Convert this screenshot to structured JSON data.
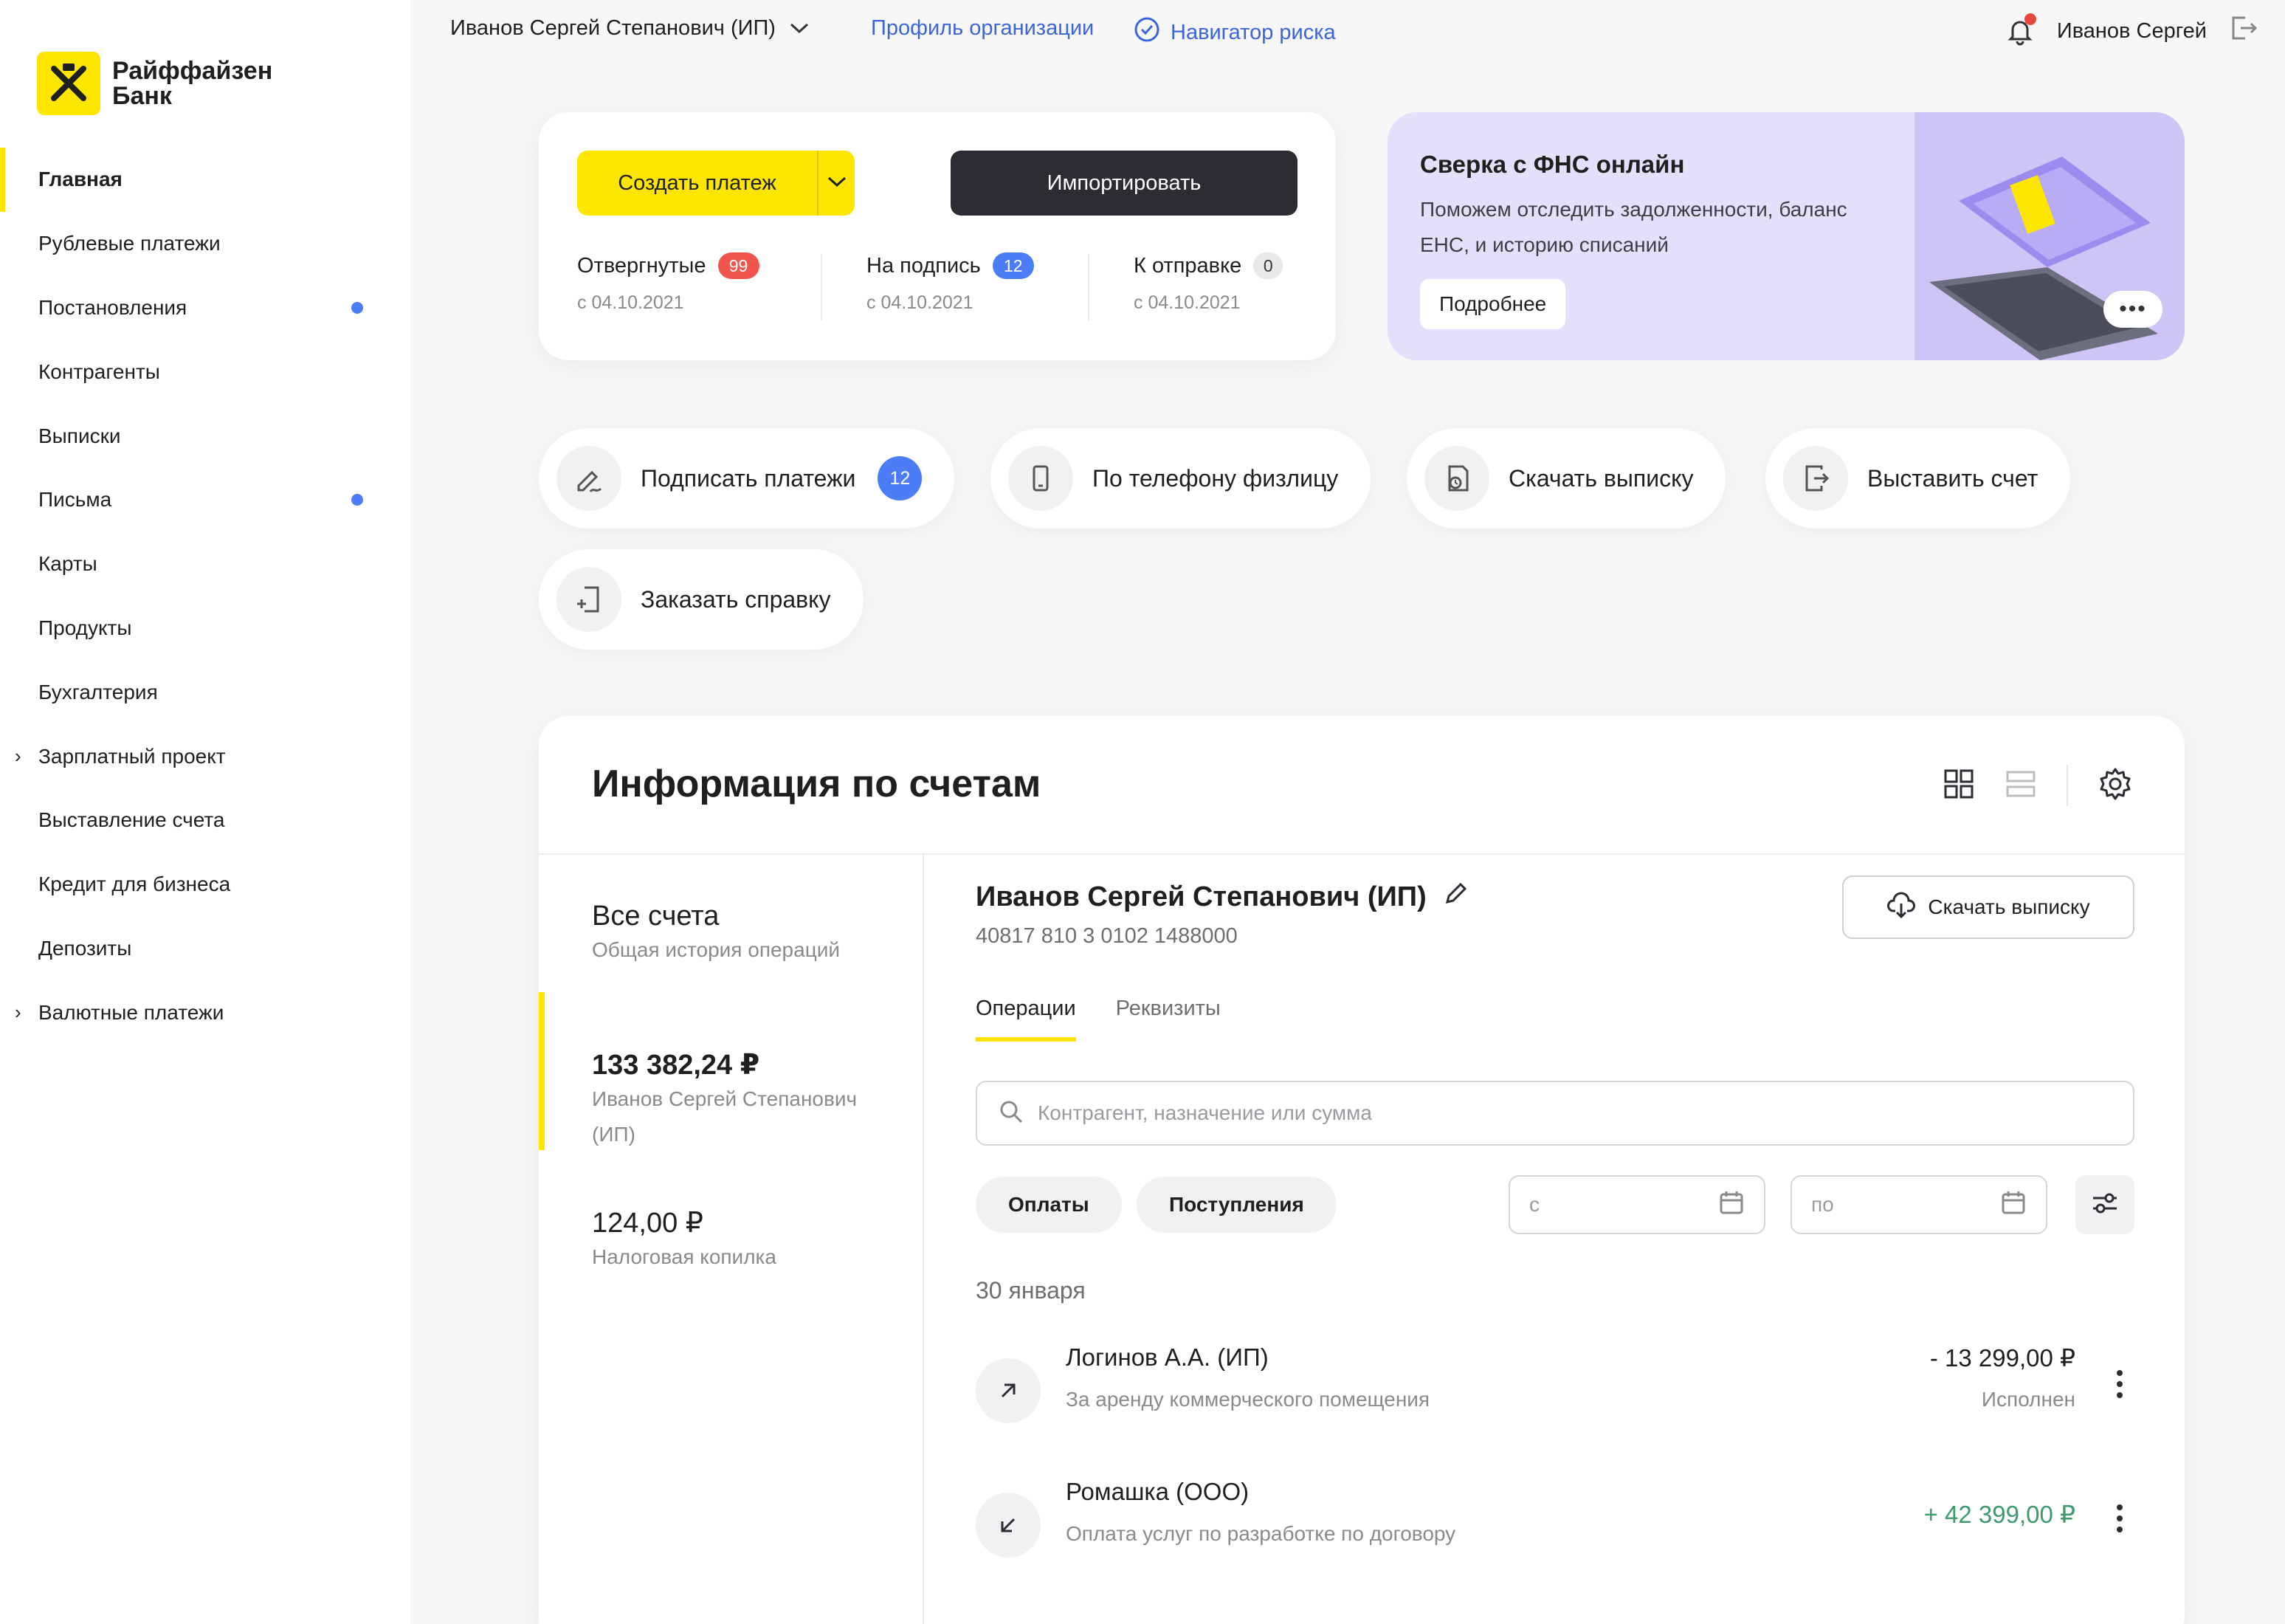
{
  "brand": {
    "name_line1": "Райффайзен",
    "name_line2": "Банк",
    "accent": "#fee600"
  },
  "sidebar": {
    "items": [
      {
        "label": "Главная",
        "active": true,
        "dot": false,
        "expandable": false
      },
      {
        "label": "Рублевые платежи",
        "active": false,
        "dot": false,
        "expandable": false
      },
      {
        "label": "Постановления",
        "active": false,
        "dot": true,
        "expandable": false
      },
      {
        "label": "Контрагенты",
        "active": false,
        "dot": false,
        "expandable": false
      },
      {
        "label": "Выписки",
        "active": false,
        "dot": false,
        "expandable": false
      },
      {
        "label": "Письма",
        "active": false,
        "dot": true,
        "expandable": false
      },
      {
        "label": "Карты",
        "active": false,
        "dot": false,
        "expandable": false
      },
      {
        "label": "Продукты",
        "active": false,
        "dot": false,
        "expandable": false
      },
      {
        "label": "Бухгалтерия",
        "active": false,
        "dot": false,
        "expandable": false
      },
      {
        "label": "Зарплатный проект",
        "active": false,
        "dot": false,
        "expandable": true
      },
      {
        "label": "Выставление счета",
        "active": false,
        "dot": false,
        "expandable": false
      },
      {
        "label": "Кредит для бизнеса",
        "active": false,
        "dot": false,
        "expandable": false
      },
      {
        "label": "Депозиты",
        "active": false,
        "dot": false,
        "expandable": false
      },
      {
        "label": "Валютные платежи",
        "active": false,
        "dot": false,
        "expandable": true
      }
    ]
  },
  "topbar": {
    "org_name": "Иванов Сергей Степанович (ИП)",
    "profile_link": "Профиль организации",
    "risk_link": "Навигатор риска",
    "user_name": "Иванов Сергей"
  },
  "payments": {
    "create_label": "Создать платеж",
    "import_label": "Импортировать",
    "stats": [
      {
        "label": "Отвергнутые",
        "count": "99",
        "date": "с 04.10.2021"
      },
      {
        "label": "На подпись",
        "count": "12",
        "date": "с 04.10.2021"
      },
      {
        "label": "К отправке",
        "count": "0",
        "date": "с 04.10.2021"
      }
    ]
  },
  "promo": {
    "title": "Сверка с ФНС онлайн",
    "text": "Поможем отследить задолженности, баланс ЕНС, и историю списаний",
    "button": "Подробнее",
    "more": "•••"
  },
  "quick_actions": [
    {
      "label": "Подписать платежи",
      "badge": "12"
    },
    {
      "label": "По телефону физлицу"
    },
    {
      "label": "Скачать выписку"
    },
    {
      "label": "Выставить счет"
    },
    {
      "label": "Заказать справку"
    }
  ],
  "accounts": {
    "title": "Информация по счетам",
    "all": {
      "title": "Все счета",
      "sub": "Общая история операций"
    },
    "list": [
      {
        "amount": "133 382,24 ₽",
        "name": "Иванов Сергей Степанович (ИП)"
      },
      {
        "amount": "124,00 ₽",
        "name": "Налоговая копилка"
      }
    ],
    "detail": {
      "name": "Иванов Сергей Степанович (ИП)",
      "number": "40817 810 3 0102 1488000",
      "download": "Скачать выписку",
      "tabs": [
        "Операции",
        "Реквизиты"
      ],
      "search_placeholder": "Контрагент, назначение или сумма",
      "chips": [
        "Оплаты",
        "Поступления"
      ],
      "date_from": "с",
      "date_to": "по",
      "group_date": "30 января",
      "operations": [
        {
          "name": "Логинов А.А. (ИП)",
          "desc": "За аренду коммерческого помещения",
          "amount": "- 13 299,00 ₽",
          "status": "Исполнен",
          "direction": "out"
        },
        {
          "name": "Ромашка (ООО)",
          "desc": "Оплата услуг по разработке по договору",
          "amount": "+ 42 399,00 ₽",
          "status": "",
          "direction": "in"
        }
      ]
    }
  }
}
